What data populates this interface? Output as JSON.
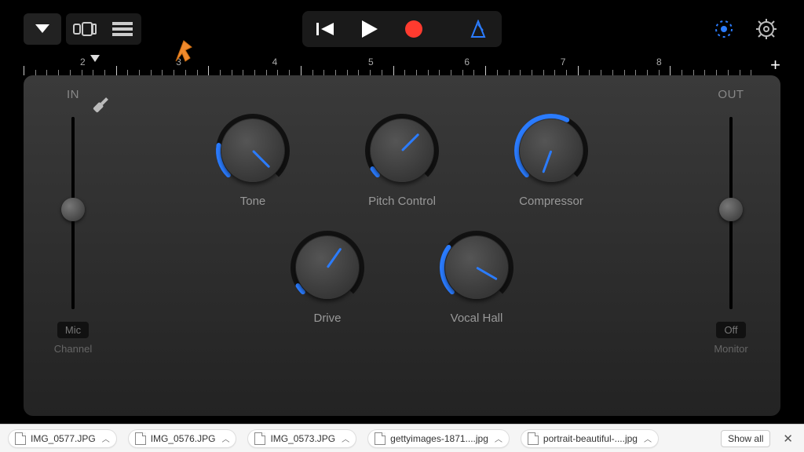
{
  "toolbar": {
    "track_settings": "track-settings",
    "browser": "browser",
    "tracks_view": "tracks-view"
  },
  "transport": {
    "rewind": "rewind",
    "play": "play",
    "record": "record",
    "metronome": "metronome"
  },
  "ruler": {
    "numbers": [
      "2",
      "3",
      "4",
      "5",
      "6",
      "7",
      "8"
    ],
    "add": "+"
  },
  "io": {
    "in_label": "IN",
    "out_label": "OUT",
    "mic_btn": "Mic",
    "off_btn": "Off",
    "channel_label": "Channel",
    "monitor_label": "Monitor",
    "in_value_pct": 48,
    "out_value_pct": 48
  },
  "knobs": [
    {
      "label": "Tone",
      "angle": 315,
      "fill": 0.2
    },
    {
      "label": "Pitch Control",
      "angle": 225,
      "fill": 0.05
    },
    {
      "label": "Compressor",
      "angle": 20,
      "fill": 0.6
    },
    {
      "label": "Drive",
      "angle": 215,
      "fill": 0.05
    },
    {
      "label": "Vocal Hall",
      "angle": 300,
      "fill": 0.3
    }
  ],
  "colors": {
    "accent": "#2b7cff",
    "record": "#ff3b2f",
    "orange": "#f08a2c"
  },
  "downloads": {
    "items": [
      "IMG_0577.JPG",
      "IMG_0576.JPG",
      "IMG_0573.JPG",
      "gettyimages-1871....jpg",
      "portrait-beautiful-....jpg"
    ],
    "show_all": "Show all"
  }
}
